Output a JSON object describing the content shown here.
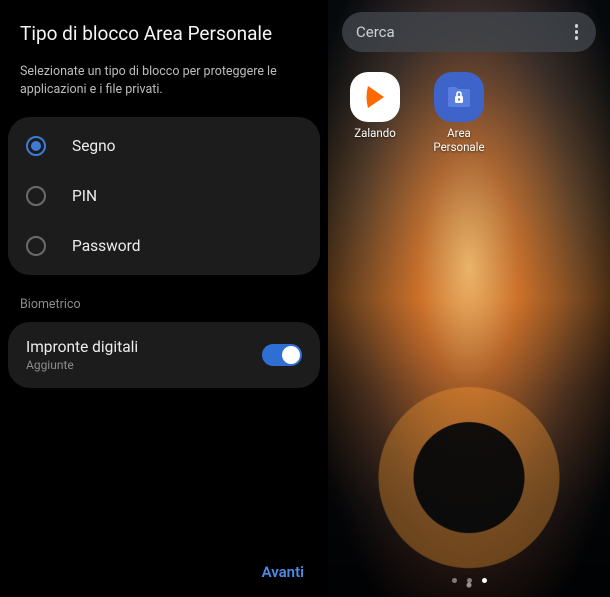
{
  "left": {
    "title": "Tipo di blocco Area Personale",
    "subtitle": "Selezionate un tipo di blocco per proteggere le applicazioni e i file privati.",
    "options": [
      {
        "label": "Segno",
        "selected": true
      },
      {
        "label": "PIN",
        "selected": false
      },
      {
        "label": "Password",
        "selected": false
      }
    ],
    "biometric_section": "Biometrico",
    "fingerprint": {
      "title": "Impronte digitali",
      "subtitle": "Aggiunte",
      "enabled": true
    },
    "next": "Avanti"
  },
  "right": {
    "search_placeholder": "Cerca",
    "apps": [
      {
        "label": "Zalando"
      },
      {
        "label": "Area\nPersonale"
      }
    ],
    "page_count": 3,
    "active_page": 2
  }
}
